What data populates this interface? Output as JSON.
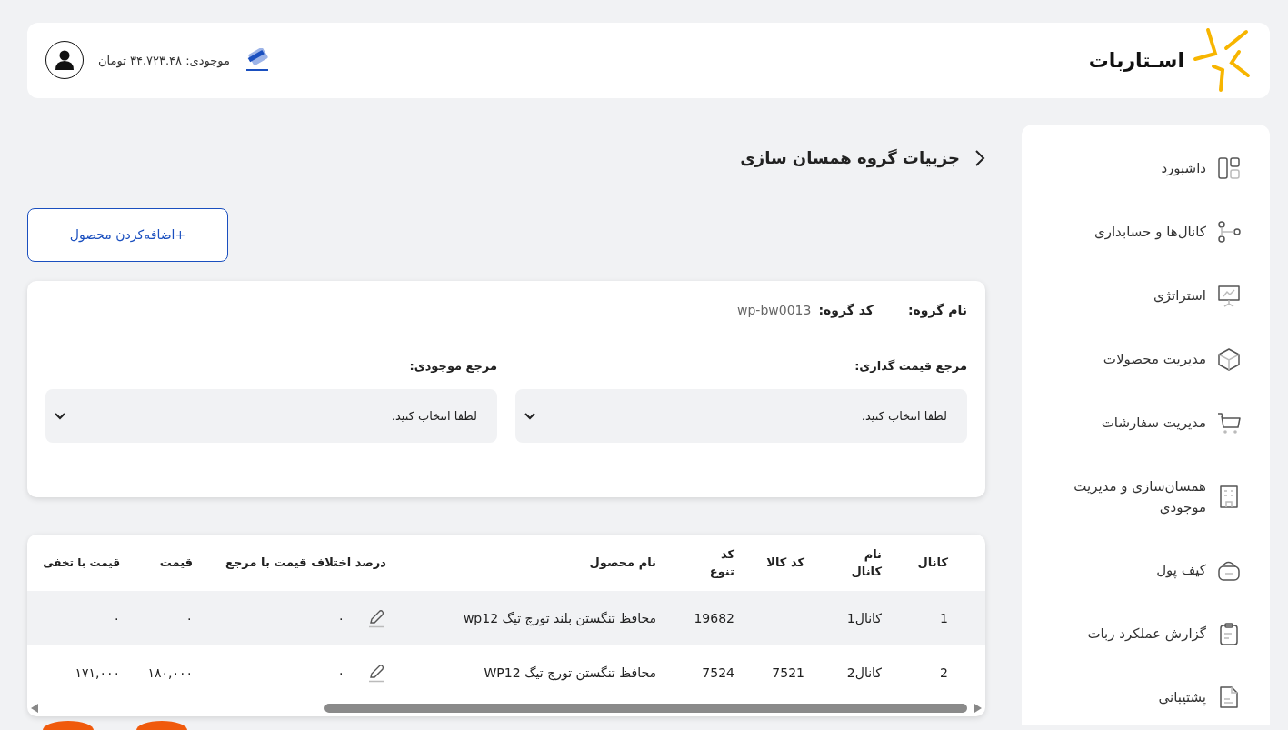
{
  "header": {
    "logo_text": "اسـتاربات",
    "balance_text": "موجودی: ۳۴,۷۲۳.۴۸ تومان"
  },
  "sidebar": {
    "items": [
      {
        "kind": "dashboard",
        "label": "داشبورد"
      },
      {
        "kind": "channels",
        "label": "کانال‌ها و حسابداری"
      },
      {
        "kind": "strategy",
        "label": "استراتژی"
      },
      {
        "kind": "products",
        "label": "مدیریت محصولات"
      },
      {
        "kind": "orders",
        "label": "مدیریت سفارشات"
      },
      {
        "kind": "sync",
        "label": "همسان‌سازی و مدیریت موجودی"
      },
      {
        "kind": "wallet",
        "label": "کیف پول"
      },
      {
        "kind": "report",
        "label": "گزارش عملکرد ربات"
      },
      {
        "kind": "support",
        "label": "پشتیبانی"
      }
    ]
  },
  "page_title": "جزییات گروه همسان سازی",
  "add_button": "+اضافه‌کردن محصول",
  "group": {
    "name_label": "نام گروه:",
    "code_label": "کد گروه:",
    "code_value": "wp-bw0013",
    "selects": [
      {
        "label": "مرجع قیمت گذاری:",
        "placeholder": "لطفا انتخاب کنید."
      },
      {
        "label": "مرجع موجودی:",
        "placeholder": "لطفا انتخاب کنید."
      }
    ]
  },
  "table": {
    "columns": [
      "کانال",
      "نام کانال",
      "کد کالا",
      "کد تنوع",
      "نام محصول",
      "درصد اختلاف قیمت با مرجع",
      "قیمت",
      "قیمت با تخفی"
    ],
    "rows": [
      [
        "1",
        "کانال1",
        null,
        "19682",
        "محافظ تنگستن بلند تورچ تیگ wp12",
        "۰",
        "۰",
        "۰"
      ],
      [
        "2",
        "کانال2",
        "7521",
        "7524",
        "محافظ تنگستن تورچ تیگ WP12",
        "۰",
        "۱۸۰,۰۰۰",
        "۱۷۱,۰۰۰"
      ]
    ]
  }
}
